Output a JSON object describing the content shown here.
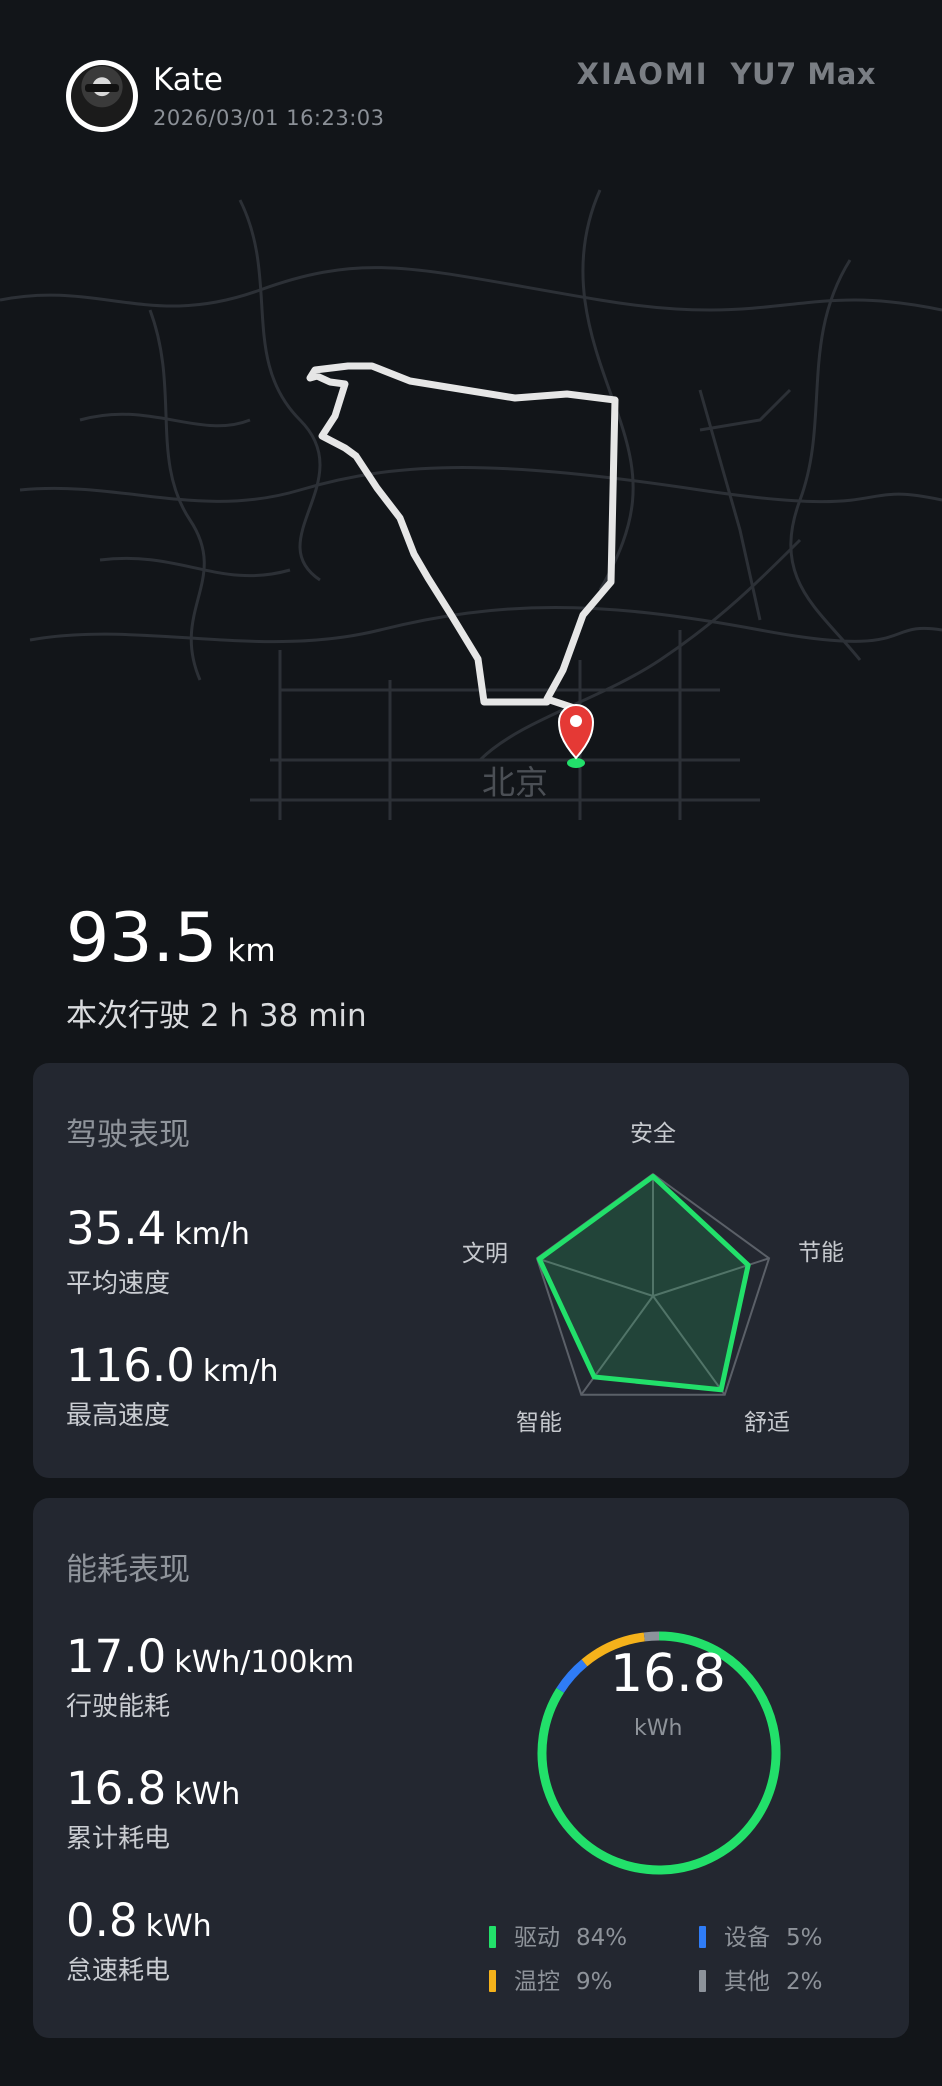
{
  "header": {
    "user_name": "Kate",
    "datetime": "2026/03/01 16:23:03",
    "brand": "XIAOMI",
    "model": "YU7 Max"
  },
  "map": {
    "city_label": "北京",
    "marker_icon": "location-pin-icon",
    "marker_color": "#e53935",
    "route_color": "#e6e6e6"
  },
  "trip": {
    "distance": "93.5",
    "distance_unit": "km",
    "duration_label": "本次行驶 2 h 38 min"
  },
  "driving": {
    "title": "驾驶表现",
    "avg_speed": "35.4",
    "avg_speed_unit": "km/h",
    "avg_speed_label": "平均速度",
    "max_speed": "116.0",
    "max_speed_unit": "km/h",
    "max_speed_label": "最高速度",
    "radar": {
      "axes": [
        "安全",
        "节能",
        "舒适",
        "智能",
        "文明"
      ],
      "values": [
        0.98,
        0.82,
        0.95,
        0.82,
        0.98
      ],
      "color": "#22e06a"
    }
  },
  "energy": {
    "title": "能耗表现",
    "consumption": "17.0",
    "consumption_unit": "kWh/100km",
    "consumption_label": "行驶能耗",
    "total": "16.8",
    "total_unit": "kWh",
    "total_label": "累计耗电",
    "idle": "0.8",
    "idle_unit": "kWh",
    "idle_label": "怠速耗电",
    "ring_value": "16.8",
    "ring_unit": "kWh",
    "legend": [
      {
        "name": "驱动",
        "pct": "84%",
        "value": 84,
        "color": "#22e06a"
      },
      {
        "name": "设备",
        "pct": "5%",
        "value": 5,
        "color": "#2f7cf6"
      },
      {
        "name": "温控",
        "pct": "9%",
        "value": 9,
        "color": "#f5b21b"
      },
      {
        "name": "其他",
        "pct": "2%",
        "value": 2,
        "color": "#8d939b"
      }
    ]
  }
}
